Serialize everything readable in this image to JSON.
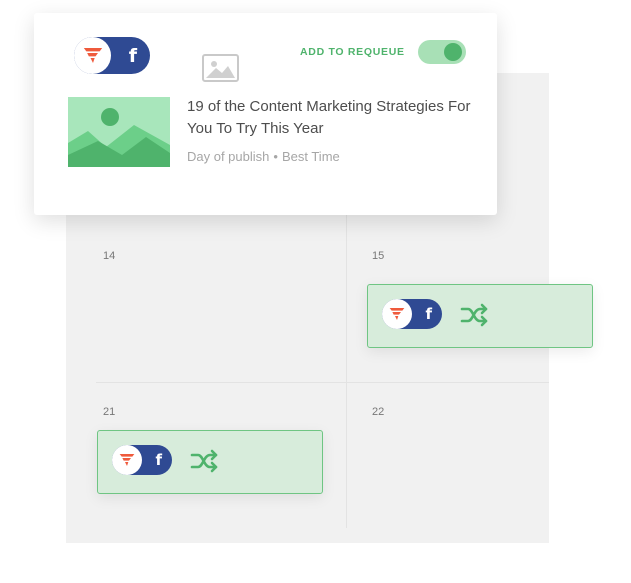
{
  "card": {
    "title": "19 of the Content Marketing Strategies For You To Try This Year",
    "meta_day": "Day of publish",
    "meta_separator": "•",
    "meta_time": "Best Time",
    "requeue_label": "ADD TO REQUEUE",
    "requeue_on": true,
    "social_letter": "f"
  },
  "calendar": {
    "days": [
      "14",
      "15",
      "21",
      "22"
    ],
    "posts": [
      {
        "day": "15",
        "social_letter": "f",
        "action_icon": "shuffle-icon"
      },
      {
        "day": "21",
        "social_letter": "f",
        "action_icon": "shuffle-icon"
      }
    ]
  },
  "colors": {
    "accent_green": "#4fb36c",
    "facebook_blue": "#2f4a93",
    "brand_orange": "#ef5a3c",
    "post_bg": "#d7ecdb",
    "calendar_bg": "#f1f1f1"
  },
  "icons": [
    "brand-logo-icon",
    "facebook-icon",
    "image-icon",
    "shuffle-icon",
    "landscape-thumbnail"
  ]
}
